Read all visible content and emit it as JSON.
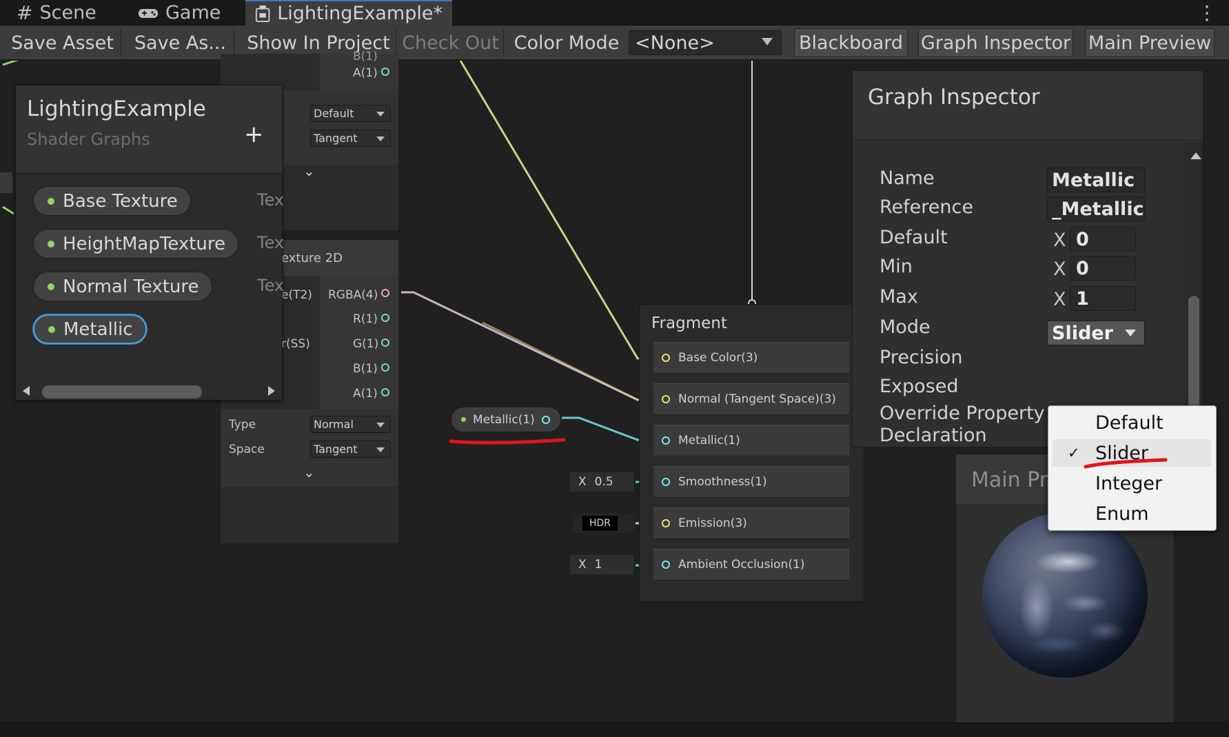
{
  "tabs": [
    {
      "label": "Scene",
      "icon": "grid-hash-icon"
    },
    {
      "label": "Game",
      "icon": "gamepad-icon"
    },
    {
      "label": "LightingExample*",
      "icon": "shader-graph-icon"
    }
  ],
  "toolbar": {
    "save_asset": "Save Asset",
    "save_as": "Save As...",
    "show_in_project": "Show In Project",
    "check_out": "Check Out",
    "color_mode_label": "Color Mode",
    "color_mode_value": "<None>",
    "blackboard": "Blackboard",
    "graph_inspector": "Graph Inspector",
    "main_preview": "Main Preview"
  },
  "blackboard": {
    "title": "LightingExample",
    "subtitle": "Shader Graphs",
    "add_symbol": "+",
    "properties": [
      {
        "name": "Base Texture",
        "type": "Tex"
      },
      {
        "name": "HeightMapTexture",
        "type": "Tex"
      },
      {
        "name": "Normal Texture",
        "type": "Tex"
      },
      {
        "name": "Metallic",
        "type": ""
      }
    ]
  },
  "texture_node": {
    "top_port_partial": "B(1)",
    "top_port": "A(1)",
    "dropdown1": "Default",
    "dropdown2": "Tangent",
    "title": "exture 2D",
    "in_t2": "e(T2)",
    "in_ss": "r(SS)",
    "outputs": [
      "RGBA(4)",
      "R(1)",
      "G(1)",
      "B(1)",
      "A(1)"
    ],
    "type_label": "Type",
    "type_value": "Normal",
    "space_label": "Space",
    "space_value": "Tangent"
  },
  "metallic_node": {
    "label": "Metallic(1)"
  },
  "fragment": {
    "title": "Fragment",
    "slots": [
      "Base Color(3)",
      "Normal (Tangent Space)(3)",
      "Metallic(1)",
      "Smoothness(1)",
      "Emission(3)",
      "Ambient Occlusion(1)"
    ],
    "smoothness_x": "X",
    "smoothness_value": "0.5",
    "emission_value": "HDR",
    "ao_x": "X",
    "ao_value": "1"
  },
  "inspector": {
    "title": "Graph Inspector",
    "name_label": "Name",
    "name_value": "Metallic",
    "reference_label": "Reference",
    "reference_value": "_Metallic",
    "default_label": "Default",
    "default_x": "X",
    "default_value": "0",
    "min_label": "Min",
    "min_x": "X",
    "min_value": "0",
    "max_label": "Max",
    "max_x": "X",
    "max_value": "1",
    "mode_label": "Mode",
    "mode_value": "Slider",
    "precision_label": "Precision",
    "exposed_label": "Exposed",
    "override_label_1": "Override Property",
    "override_label_2": "Declaration"
  },
  "mode_menu": {
    "items": [
      "Default",
      "Slider",
      "Integer",
      "Enum"
    ],
    "selected": "Slider",
    "check": "✓"
  },
  "main_preview": {
    "title": "Main Preview"
  },
  "colors": {
    "accent": "#3a79bb",
    "selection": "#4aa1d8",
    "annotation": "#e0141e",
    "wire_pink": "#cbb2c8",
    "wire_yellow": "#d1cf86",
    "wire_cyan": "#6fc6cf"
  }
}
